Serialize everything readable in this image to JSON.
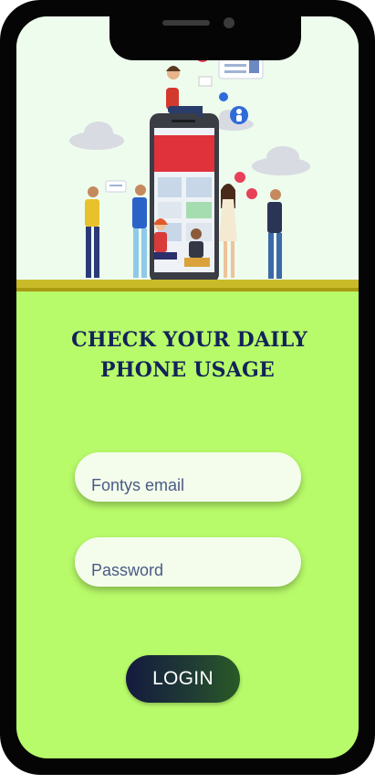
{
  "heading": {
    "line1": "CHECK YOUR DAILY",
    "line2": "PHONE USAGE"
  },
  "form": {
    "email_placeholder": "Fontys email",
    "password_placeholder": "Password",
    "login_label": "LOGIN"
  },
  "colors": {
    "screen_background": "#b8fb6a",
    "heading_text": "#12235a",
    "button_gradient_start": "#141a3f",
    "button_gradient_end": "#2a5a26",
    "input_background": "#f4fdec"
  },
  "illustration": {
    "subject": "people-using-phones-around-giant-smartphone"
  }
}
